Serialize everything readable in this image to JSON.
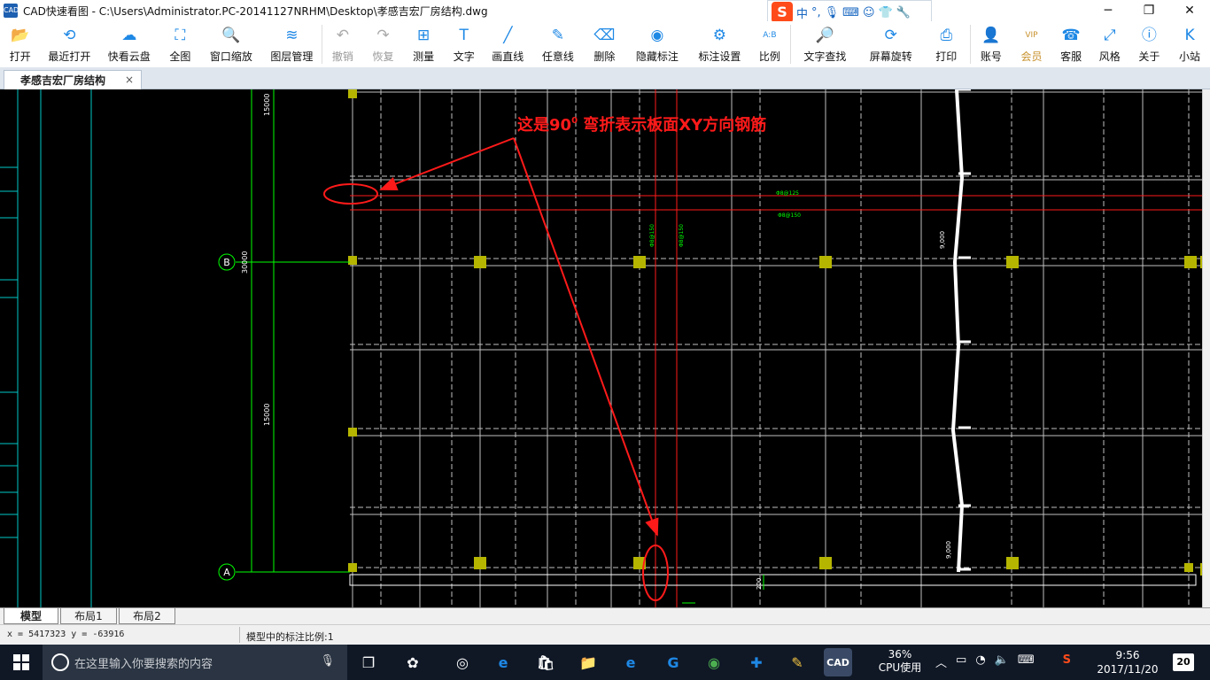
{
  "titlebar": {
    "title": "CAD快速看图 - C:\\Users\\Administrator.PC-20141127NRHM\\Desktop\\孝感吉宏厂房结构.dwg",
    "icon_text": "CAD"
  },
  "ime": {
    "logo": "S",
    "mode": "中",
    "punct": "°,",
    "icons": [
      "mic-icon",
      "keyboard-icon",
      "user-icon",
      "shirt-icon",
      "wrench-icon"
    ]
  },
  "toolbar": {
    "buttons": [
      {
        "label": "打开",
        "icon": "folder-icon",
        "glyph": "📂"
      },
      {
        "label": "最近打开",
        "icon": "history-icon",
        "glyph": "⟲"
      },
      {
        "label": "快看云盘",
        "icon": "cloud-icon",
        "glyph": "☁"
      },
      {
        "label": "全图",
        "icon": "fit-icon",
        "glyph": "⛶"
      },
      {
        "label": "窗口缩放",
        "icon": "zoom-window-icon",
        "glyph": "🔍"
      },
      {
        "label": "图层管理",
        "icon": "layers-icon",
        "glyph": "≋"
      },
      {
        "label": "撤销",
        "icon": "undo-icon",
        "glyph": "↶"
      },
      {
        "label": "恢复",
        "icon": "redo-icon",
        "glyph": "↷"
      },
      {
        "label": "测量",
        "icon": "ruler-icon",
        "glyph": "⊞"
      },
      {
        "label": "文字",
        "icon": "text-icon",
        "glyph": "T"
      },
      {
        "label": "画直线",
        "icon": "line-icon",
        "glyph": "╱"
      },
      {
        "label": "任意线",
        "icon": "pen-icon",
        "glyph": "✎"
      },
      {
        "label": "删除",
        "icon": "eraser-icon",
        "glyph": "⌫"
      },
      {
        "label": "隐藏标注",
        "icon": "eye-hide-icon",
        "glyph": "◉"
      },
      {
        "label": "标注设置",
        "icon": "settings-icon",
        "glyph": "⚙"
      },
      {
        "label": "比例",
        "icon": "scale-icon",
        "glyph": "A:B"
      },
      {
        "label": "文字查找",
        "icon": "find-text-icon",
        "glyph": "🔎"
      },
      {
        "label": "屏幕旋转",
        "icon": "rotate-icon",
        "glyph": "⟳"
      },
      {
        "label": "打印",
        "icon": "printer-icon",
        "glyph": "⎙"
      },
      {
        "label": "账号",
        "icon": "account-icon",
        "glyph": "👤"
      },
      {
        "label": "会员",
        "icon": "vip-icon",
        "glyph": "VIP"
      },
      {
        "label": "客服",
        "icon": "headset-icon",
        "glyph": "☎"
      },
      {
        "label": "风格",
        "icon": "style-icon",
        "glyph": "⤢"
      },
      {
        "label": "关于",
        "icon": "info-icon",
        "glyph": "ⓘ"
      },
      {
        "label": "小站",
        "icon": "site-icon",
        "glyph": "K"
      }
    ]
  },
  "tabs": {
    "document": "孝感吉宏厂房结构",
    "close": "×"
  },
  "drawing": {
    "annotation": "这是90",
    "annotation_sup": "0",
    "annotation_rest": " 弯折表示板面XY方向钢筋",
    "grid_labels": {
      "b": "B",
      "a": "A"
    },
    "dims": {
      "d1": "15000",
      "d2": "30000",
      "d3": "15000",
      "d4": "9,000",
      "d5": "9,000",
      "d6": "200"
    },
    "rebar_labels": {
      "r1": "Φ8@125",
      "r2": "Φ8@150",
      "r3": "Φ8@150",
      "r4": "Φ8@150"
    },
    "colors": {
      "annotation": "#ff1a1a",
      "grid": "#00ff00",
      "column": "#b5b500",
      "line": "#bfbfbf"
    }
  },
  "layout_tabs": [
    "模型",
    "布局1",
    "布局2"
  ],
  "status": {
    "coords": "x = 5417323   y = -63916",
    "scale": "模型中的标注比例:1"
  },
  "taskbar": {
    "search_placeholder": "在这里输入你要搜索的内容",
    "cpu_percent": "36%",
    "cpu_label": "CPU使用",
    "time": "9:56",
    "date": "2017/11/20",
    "notifications": "20",
    "ime_tray": "S"
  }
}
